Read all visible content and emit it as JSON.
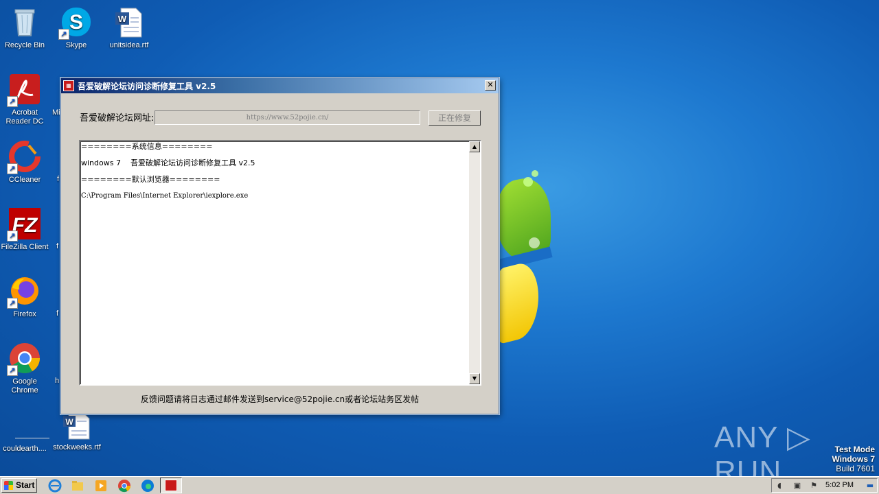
{
  "desktop": {
    "icons": [
      {
        "label": "Recycle Bin",
        "icon": "recycle-bin-icon"
      },
      {
        "label": "Skype",
        "icon": "skype-icon"
      },
      {
        "label": "unitsidea.rtf",
        "icon": "word-document-icon"
      },
      {
        "label": "Acrobat Reader DC",
        "icon": "acrobat-icon"
      },
      {
        "label": "Mi",
        "icon": "partially-hidden-icon"
      },
      {
        "label": "CCleaner",
        "icon": "ccleaner-icon"
      },
      {
        "label": "FileZilla Client",
        "icon": "filezilla-icon"
      },
      {
        "label": "Firefox",
        "icon": "firefox-icon"
      },
      {
        "label": "Google Chrome",
        "icon": "chrome-icon"
      },
      {
        "label": "couldearth....",
        "icon": "blank-file-icon"
      },
      {
        "label": "stockweeks.rtf",
        "icon": "word-document-icon"
      }
    ]
  },
  "dialog": {
    "title": "吾爱破解论坛访问诊断修复工具 v2.5",
    "close_glyph": "✕",
    "url_label": "吾爱破解论坛网址:",
    "url_value": "https://www.52pojie.cn/",
    "fix_button": "正在修复",
    "log_lines": [
      "========系统信息========",
      "windows 7    吾爱破解论坛访问诊断修复工具 v2.5",
      "========默认浏览器========",
      "C:\\Program Files\\Internet Explorer\\iexplore.exe"
    ],
    "footer": "反馈问题请将日志通过邮件发送到service@52pojie.cn或者论坛站务区发帖"
  },
  "watermark": "ANY ▷ RUN",
  "test_mode": {
    "line1": "Test Mode",
    "line2": "Windows 7",
    "line3": "Build 7601"
  },
  "taskbar": {
    "start_label": "Start",
    "pinned": [
      "ie-icon",
      "explorer-icon",
      "media-player-icon",
      "chrome-icon",
      "edge-icon"
    ],
    "time": "5:02 PM"
  },
  "colors": {
    "desktop_blue": "#1d78cf",
    "title_bar": "#0a246a",
    "dialog_bg": "#d4d0c8"
  }
}
